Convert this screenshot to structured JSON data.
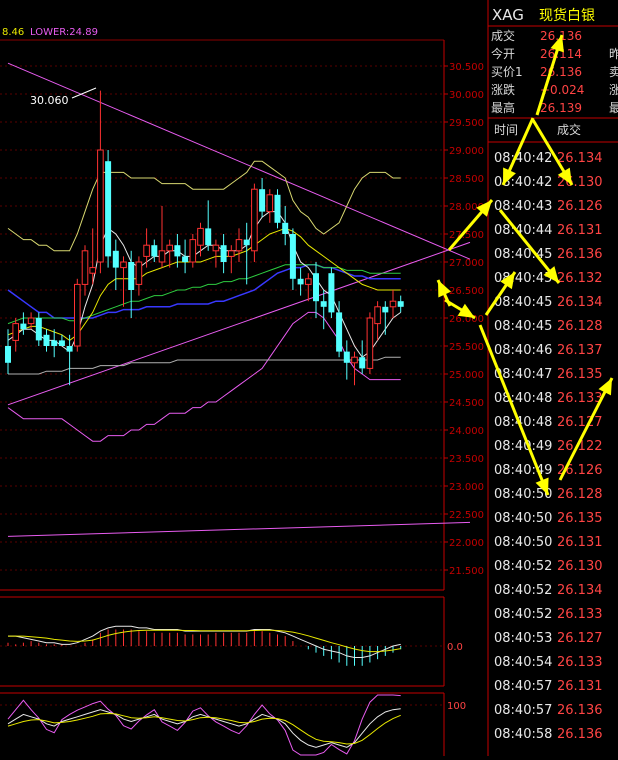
{
  "indicator_header": {
    "mid_value": "8.46",
    "lower_label": "LOWER:24.89"
  },
  "annotation_high": "30.060",
  "chart_data": {
    "type": "candlestick",
    "y_ticks": [
      "30.500",
      "30.000",
      "29.500",
      "29.000",
      "28.500",
      "28.000",
      "27.500",
      "27.000",
      "26.500",
      "26.000",
      "25.500",
      "25.000",
      "24.500",
      "24.000",
      "23.500",
      "23.000",
      "22.500",
      "22.000",
      "21.500"
    ],
    "ylim": [
      21.2,
      31.0
    ],
    "candles": [
      {
        "o": 25.5,
        "h": 25.8,
        "l": 25.0,
        "c": 25.2
      },
      {
        "o": 25.6,
        "h": 26.0,
        "l": 25.4,
        "c": 25.9
      },
      {
        "o": 25.9,
        "h": 26.1,
        "l": 25.7,
        "c": 25.8
      },
      {
        "o": 25.9,
        "h": 26.1,
        "l": 25.8,
        "c": 26.0
      },
      {
        "o": 26.0,
        "h": 26.1,
        "l": 25.5,
        "c": 25.6
      },
      {
        "o": 25.7,
        "h": 25.8,
        "l": 25.4,
        "c": 25.5
      },
      {
        "o": 25.6,
        "h": 25.8,
        "l": 25.3,
        "c": 25.5
      },
      {
        "o": 25.6,
        "h": 25.7,
        "l": 25.5,
        "c": 25.5
      },
      {
        "o": 25.5,
        "h": 25.7,
        "l": 24.8,
        "c": 25.4
      },
      {
        "o": 25.5,
        "h": 26.7,
        "l": 25.4,
        "c": 26.6
      },
      {
        "o": 26.6,
        "h": 27.3,
        "l": 26.4,
        "c": 27.2
      },
      {
        "o": 26.8,
        "h": 27.6,
        "l": 26.6,
        "c": 26.9
      },
      {
        "o": 27.0,
        "h": 30.06,
        "l": 26.8,
        "c": 29.0
      },
      {
        "o": 28.8,
        "h": 29.0,
        "l": 26.9,
        "c": 27.1
      },
      {
        "o": 27.2,
        "h": 27.4,
        "l": 26.5,
        "c": 26.9
      },
      {
        "o": 26.9,
        "h": 27.1,
        "l": 26.2,
        "c": 27.0
      },
      {
        "o": 27.0,
        "h": 27.2,
        "l": 26.0,
        "c": 26.5
      },
      {
        "o": 26.6,
        "h": 27.1,
        "l": 26.4,
        "c": 27.0
      },
      {
        "o": 27.1,
        "h": 27.6,
        "l": 26.9,
        "c": 27.3
      },
      {
        "o": 27.3,
        "h": 27.4,
        "l": 27.0,
        "c": 27.1
      },
      {
        "o": 27.0,
        "h": 28.0,
        "l": 26.9,
        "c": 27.2
      },
      {
        "o": 27.2,
        "h": 27.4,
        "l": 26.9,
        "c": 27.3
      },
      {
        "o": 27.3,
        "h": 27.5,
        "l": 26.9,
        "c": 27.1
      },
      {
        "o": 27.1,
        "h": 27.4,
        "l": 26.8,
        "c": 27.0
      },
      {
        "o": 27.0,
        "h": 27.5,
        "l": 26.9,
        "c": 27.4
      },
      {
        "o": 27.3,
        "h": 27.7,
        "l": 27.1,
        "c": 27.6
      },
      {
        "o": 27.6,
        "h": 28.1,
        "l": 27.2,
        "c": 27.3
      },
      {
        "o": 27.2,
        "h": 27.4,
        "l": 26.9,
        "c": 27.3
      },
      {
        "o": 27.3,
        "h": 27.5,
        "l": 26.8,
        "c": 27.0
      },
      {
        "o": 27.1,
        "h": 27.3,
        "l": 26.8,
        "c": 27.2
      },
      {
        "o": 27.2,
        "h": 27.6,
        "l": 27.0,
        "c": 27.4
      },
      {
        "o": 27.4,
        "h": 27.7,
        "l": 26.6,
        "c": 27.3
      },
      {
        "o": 27.2,
        "h": 28.4,
        "l": 27.0,
        "c": 28.3
      },
      {
        "o": 28.3,
        "h": 28.5,
        "l": 27.8,
        "c": 27.9
      },
      {
        "o": 27.9,
        "h": 28.3,
        "l": 27.7,
        "c": 28.2
      },
      {
        "o": 28.2,
        "h": 28.3,
        "l": 27.6,
        "c": 27.7
      },
      {
        "o": 27.7,
        "h": 28.0,
        "l": 27.3,
        "c": 27.5
      },
      {
        "o": 27.5,
        "h": 27.6,
        "l": 26.5,
        "c": 26.7
      },
      {
        "o": 26.7,
        "h": 26.9,
        "l": 26.4,
        "c": 26.6
      },
      {
        "o": 26.6,
        "h": 26.8,
        "l": 26.3,
        "c": 26.7
      },
      {
        "o": 26.8,
        "h": 27.0,
        "l": 26.0,
        "c": 26.3
      },
      {
        "o": 26.3,
        "h": 26.5,
        "l": 25.8,
        "c": 26.2
      },
      {
        "o": 26.8,
        "h": 26.9,
        "l": 26.0,
        "c": 26.1
      },
      {
        "o": 26.1,
        "h": 26.3,
        "l": 25.3,
        "c": 25.4
      },
      {
        "o": 25.4,
        "h": 25.6,
        "l": 24.9,
        "c": 25.2
      },
      {
        "o": 25.2,
        "h": 25.4,
        "l": 24.8,
        "c": 25.3
      },
      {
        "o": 25.3,
        "h": 25.6,
        "l": 25.0,
        "c": 25.1
      },
      {
        "o": 25.1,
        "h": 26.1,
        "l": 25.0,
        "c": 26.0
      },
      {
        "o": 25.9,
        "h": 26.3,
        "l": 25.6,
        "c": 26.2
      },
      {
        "o": 26.2,
        "h": 26.3,
        "l": 25.7,
        "c": 26.1
      },
      {
        "o": 26.2,
        "h": 26.5,
        "l": 26.0,
        "c": 26.3
      },
      {
        "o": 26.3,
        "h": 26.4,
        "l": 26.1,
        "c": 26.2
      }
    ],
    "ma_fast": [
      25.6,
      25.7,
      25.8,
      25.8,
      25.7,
      25.6,
      25.6,
      25.5,
      25.4,
      25.7,
      26.2,
      26.6,
      27.3,
      27.6,
      27.5,
      27.3,
      27.0,
      26.9,
      27.0,
      27.1,
      27.1,
      27.2,
      27.2,
      27.1,
      27.1,
      27.2,
      27.3,
      27.3,
      27.2,
      27.2,
      27.2,
      27.3,
      27.6,
      27.8,
      27.9,
      27.9,
      27.7,
      27.3,
      27.0,
      26.9,
      26.7,
      26.5,
      26.4,
      26.1,
      25.8,
      25.5,
      25.3,
      25.4,
      25.6,
      25.8,
      26.0,
      26.1
    ],
    "ma_mid": [
      25.7,
      25.75,
      25.8,
      25.85,
      25.85,
      25.8,
      25.75,
      25.7,
      25.6,
      25.7,
      25.9,
      26.1,
      26.4,
      26.6,
      26.7,
      26.7,
      26.7,
      26.7,
      26.8,
      26.85,
      26.9,
      26.95,
      27.0,
      27.0,
      27.0,
      27.0,
      27.05,
      27.1,
      27.1,
      27.1,
      27.15,
      27.2,
      27.3,
      27.4,
      27.5,
      27.55,
      27.6,
      27.55,
      27.45,
      27.3,
      27.2,
      27.1,
      27.0,
      26.9,
      26.8,
      26.7,
      26.6,
      26.55,
      26.5,
      26.5,
      26.5,
      26.5
    ],
    "ma_slow": [
      25.9,
      25.95,
      26.0,
      26.0,
      26.0,
      26.0,
      26.0,
      26.0,
      25.95,
      25.95,
      26.0,
      26.05,
      26.1,
      26.15,
      26.2,
      26.25,
      26.3,
      26.3,
      26.35,
      26.4,
      26.4,
      26.45,
      26.5,
      26.5,
      26.55,
      26.55,
      26.6,
      26.6,
      26.65,
      26.65,
      26.7,
      26.7,
      26.75,
      26.8,
      26.85,
      26.9,
      26.95,
      26.95,
      26.95,
      26.95,
      26.95,
      26.9,
      26.9,
      26.9,
      26.85,
      26.85,
      26.85,
      26.8,
      26.8,
      26.8,
      26.8,
      26.8
    ],
    "boll_mid": [
      26.5,
      26.4,
      26.3,
      26.2,
      26.1,
      26.1,
      26.0,
      26.0,
      26.0,
      26.0,
      26.0,
      26.0,
      26.05,
      26.1,
      26.1,
      26.15,
      26.15,
      26.15,
      26.2,
      26.2,
      26.2,
      26.2,
      26.25,
      26.25,
      26.25,
      26.25,
      26.25,
      26.3,
      26.3,
      26.35,
      26.4,
      26.45,
      26.5,
      26.6,
      26.7,
      26.8,
      26.85,
      26.9,
      26.9,
      26.95,
      26.95,
      26.9,
      26.9,
      26.85,
      26.8,
      26.75,
      26.75,
      26.7,
      26.7,
      26.7,
      26.7,
      26.7
    ],
    "boll_upper": [
      27.6,
      27.5,
      27.4,
      27.4,
      27.3,
      27.3,
      27.2,
      27.2,
      27.2,
      27.5,
      27.9,
      28.3,
      28.6,
      28.6,
      28.6,
      28.6,
      28.5,
      28.5,
      28.5,
      28.5,
      28.4,
      28.4,
      28.4,
      28.4,
      28.3,
      28.3,
      28.3,
      28.3,
      28.3,
      28.4,
      28.5,
      28.6,
      28.8,
      28.8,
      28.7,
      28.6,
      28.5,
      28.1,
      27.9,
      27.8,
      27.6,
      27.5,
      27.6,
      27.7,
      28.0,
      28.3,
      28.5,
      28.6,
      28.6,
      28.6,
      28.5,
      28.5
    ],
    "boll_lower": [
      24.4,
      24.3,
      24.2,
      24.2,
      24.2,
      24.2,
      24.2,
      24.2,
      24.1,
      24.0,
      23.9,
      23.8,
      23.8,
      23.9,
      23.9,
      23.9,
      24.0,
      24.0,
      24.1,
      24.1,
      24.2,
      24.3,
      24.3,
      24.3,
      24.4,
      24.4,
      24.5,
      24.5,
      24.6,
      24.7,
      24.8,
      24.9,
      25.0,
      25.1,
      25.3,
      25.5,
      25.7,
      25.9,
      26.0,
      26.1,
      26.1,
      26.0,
      25.8,
      25.6,
      25.3,
      25.1,
      25.0,
      24.9,
      24.9,
      24.9,
      24.9,
      24.9
    ],
    "flat_line": [
      25.0,
      25.0,
      25.0,
      25.0,
      25.0,
      25.05,
      25.05,
      25.05,
      25.1,
      25.1,
      25.1,
      25.1,
      25.15,
      25.15,
      25.15,
      25.15,
      25.2,
      25.2,
      25.2,
      25.2,
      25.2,
      25.2,
      25.25,
      25.25,
      25.25,
      25.25,
      25.25,
      25.25,
      25.25,
      25.25,
      25.25,
      25.25,
      25.25,
      25.25,
      25.25,
      25.25,
      25.25,
      25.25,
      25.25,
      25.25,
      25.25,
      25.25,
      25.25,
      25.25,
      25.25,
      25.25,
      25.25,
      25.25,
      25.25,
      25.3,
      25.3,
      25.3
    ],
    "trendlines": [
      {
        "color": "#e85cf0",
        "from": [
          0,
          30.55
        ],
        "to": [
          60,
          27.05
        ]
      },
      {
        "color": "#e85cf0",
        "from": [
          0,
          24.45
        ],
        "to": [
          60,
          27.35
        ]
      },
      {
        "color": "#e85cf0",
        "from": [
          0,
          22.1
        ],
        "to": [
          60,
          22.35
        ]
      }
    ],
    "macd_tick": "0.0",
    "macd_hist": [
      0.1,
      0.05,
      0.1,
      0.15,
      0.1,
      0.05,
      0.05,
      0.05,
      0.0,
      0.0,
      0.1,
      0.2,
      0.4,
      0.5,
      0.5,
      0.5,
      0.5,
      0.45,
      0.45,
      0.4,
      0.4,
      0.4,
      0.4,
      0.35,
      0.35,
      0.35,
      0.35,
      0.4,
      0.4,
      0.4,
      0.4,
      0.4,
      0.45,
      0.45,
      0.4,
      0.35,
      0.3,
      0.15,
      0.0,
      -0.1,
      -0.2,
      -0.3,
      -0.4,
      -0.5,
      -0.6,
      -0.6,
      -0.6,
      -0.5,
      -0.4,
      -0.3,
      -0.2,
      -0.1
    ],
    "macd_line": [
      0.3,
      0.3,
      0.25,
      0.2,
      0.15,
      0.1,
      0.1,
      0.05,
      0.05,
      0.1,
      0.2,
      0.3,
      0.45,
      0.55,
      0.6,
      0.6,
      0.6,
      0.55,
      0.55,
      0.5,
      0.5,
      0.5,
      0.5,
      0.45,
      0.45,
      0.45,
      0.45,
      0.45,
      0.45,
      0.45,
      0.45,
      0.45,
      0.5,
      0.5,
      0.5,
      0.45,
      0.4,
      0.3,
      0.2,
      0.1,
      0.0,
      -0.1,
      -0.15,
      -0.2,
      -0.3,
      -0.35,
      -0.35,
      -0.3,
      -0.2,
      -0.1,
      0.0,
      0.05
    ],
    "macd_signal": [
      0.3,
      0.3,
      0.3,
      0.28,
      0.26,
      0.24,
      0.2,
      0.18,
      0.15,
      0.14,
      0.15,
      0.18,
      0.25,
      0.32,
      0.38,
      0.42,
      0.45,
      0.47,
      0.48,
      0.48,
      0.48,
      0.48,
      0.48,
      0.47,
      0.47,
      0.46,
      0.46,
      0.46,
      0.46,
      0.46,
      0.46,
      0.46,
      0.47,
      0.48,
      0.48,
      0.47,
      0.45,
      0.42,
      0.37,
      0.31,
      0.24,
      0.17,
      0.1,
      0.04,
      -0.03,
      -0.09,
      -0.14,
      -0.17,
      -0.17,
      -0.15,
      -0.12,
      -0.08
    ],
    "kdj_tick": "100",
    "kdj_k": [
      60,
      70,
      80,
      75,
      70,
      60,
      55,
      65,
      70,
      75,
      80,
      85,
      90,
      85,
      80,
      70,
      65,
      70,
      75,
      80,
      70,
      65,
      60,
      65,
      75,
      80,
      75,
      70,
      65,
      60,
      55,
      60,
      70,
      80,
      75,
      70,
      60,
      40,
      25,
      15,
      10,
      15,
      20,
      15,
      10,
      20,
      40,
      60,
      75,
      85,
      90,
      92
    ],
    "kdj_d": [
      55,
      60,
      65,
      68,
      69,
      66,
      62,
      63,
      65,
      68,
      72,
      76,
      81,
      82,
      81,
      77,
      73,
      72,
      73,
      75,
      73,
      70,
      67,
      66,
      69,
      73,
      74,
      73,
      70,
      67,
      63,
      62,
      65,
      70,
      72,
      71,
      67,
      58,
      47,
      36,
      27,
      23,
      22,
      20,
      17,
      18,
      25,
      37,
      50,
      62,
      71,
      78
    ],
    "kdj_j": [
      70,
      90,
      110,
      90,
      72,
      48,
      41,
      69,
      80,
      89,
      96,
      103,
      108,
      91,
      78,
      56,
      49,
      66,
      79,
      90,
      64,
      55,
      46,
      63,
      87,
      94,
      77,
      64,
      55,
      46,
      39,
      56,
      80,
      100,
      81,
      68,
      46,
      4,
      -19,
      -27,
      -34,
      -1,
      16,
      5,
      -4,
      24,
      70,
      106,
      125,
      131,
      128,
      120
    ]
  },
  "quote_panel": {
    "symbol": "XAG",
    "name": "现货白银",
    "rows": [
      {
        "label": "成交",
        "value": "26.136",
        "extra": ""
      },
      {
        "label": "今开",
        "value": "26.114",
        "extra": "昨"
      },
      {
        "label": "买价1",
        "value": "26.136",
        "extra": "卖"
      },
      {
        "label": "涨跌",
        "value": "+0.024",
        "extra": "涨"
      },
      {
        "label": "最高",
        "value": "26.139",
        "extra": "最"
      }
    ],
    "ticks_header": {
      "time": "时间",
      "price": "成交"
    },
    "ticks": [
      {
        "time": "08:40:42",
        "price": "26.134"
      },
      {
        "time": "08:40:42",
        "price": "26.130"
      },
      {
        "time": "08:40:43",
        "price": "26.126"
      },
      {
        "time": "08:40:44",
        "price": "26.131"
      },
      {
        "time": "08:40:45",
        "price": "26.136"
      },
      {
        "time": "08:40:45",
        "price": "26.132"
      },
      {
        "time": "08:40:45",
        "price": "26.134"
      },
      {
        "time": "08:40:45",
        "price": "26.128"
      },
      {
        "time": "08:40:46",
        "price": "26.137"
      },
      {
        "time": "08:40:47",
        "price": "26.135"
      },
      {
        "time": "08:40:48",
        "price": "26.133"
      },
      {
        "time": "08:40:48",
        "price": "26.127"
      },
      {
        "time": "08:40:49",
        "price": "26.122"
      },
      {
        "time": "08:40:49",
        "price": "26.126"
      },
      {
        "time": "08:40:50",
        "price": "26.128"
      },
      {
        "time": "08:40:50",
        "price": "26.135"
      },
      {
        "time": "08:40:50",
        "price": "26.131"
      },
      {
        "time": "08:40:52",
        "price": "26.130"
      },
      {
        "time": "08:40:52",
        "price": "26.134"
      },
      {
        "time": "08:40:52",
        "price": "26.133"
      },
      {
        "time": "08:40:53",
        "price": "26.127"
      },
      {
        "time": "08:40:54",
        "price": "26.133"
      },
      {
        "time": "08:40:57",
        "price": "26.131"
      },
      {
        "time": "08:40:57",
        "price": "26.136"
      },
      {
        "time": "08:40:58",
        "price": "26.136"
      }
    ]
  },
  "colors": {
    "up": "#ff3232",
    "down": "#54ffff",
    "axis": "#c40000",
    "text_red": "#ff4444",
    "label": "#d8d8d8",
    "yellow": "#ffff00",
    "magenta": "#e85cf0",
    "ma_white": "#e8e8e8",
    "ma_yellow": "#e8e800",
    "ma_green": "#2ecc40",
    "ma_blue": "#3838ff",
    "boll": "#d8d870",
    "gray": "#b0b0b0"
  }
}
